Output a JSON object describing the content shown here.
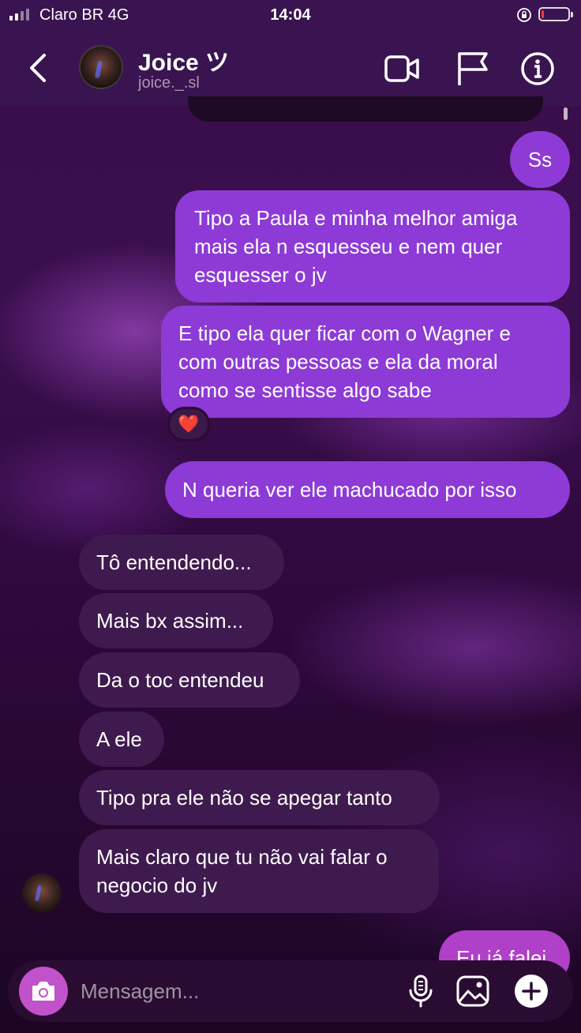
{
  "status_bar": {
    "carrier": "Claro BR   4G",
    "time": "14:04",
    "battery_level": 0.1
  },
  "header": {
    "name": "Joice ツ",
    "username": "joice._.sl",
    "icons": [
      "back-chevron-icon",
      "video-camera-icon",
      "flag-icon",
      "info-icon"
    ]
  },
  "messages": [
    {
      "from": "me",
      "lines": [
        "Ss"
      ]
    },
    {
      "from": "me",
      "lines": [
        "Tipo a Paula e minha melhor amiga",
        "mais ela n esquesseu e nem quer",
        "esquesser o jv"
      ]
    },
    {
      "from": "me",
      "lines": [
        "E tipo ela quer ficar com o Wagner e",
        "com outras pessoas e ela da moral",
        "como se sentisse algo sabe"
      ],
      "reaction": "❤️"
    },
    {
      "from": "me",
      "lines": [
        "N queria ver ele machucado por isso"
      ]
    },
    {
      "from": "them",
      "lines": [
        "Tô entendendo..."
      ]
    },
    {
      "from": "them",
      "lines": [
        "Mais bx assim..."
      ]
    },
    {
      "from": "them",
      "lines": [
        "Da o toc entendeu"
      ]
    },
    {
      "from": "them",
      "lines": [
        "A ele"
      ]
    },
    {
      "from": "them",
      "lines": [
        "Tipo pra ele não se apegar tanto"
      ]
    },
    {
      "from": "them",
      "lines": [
        "Mais claro que tu não vai falar o",
        "negocio do jv"
      ]
    },
    {
      "from": "me",
      "lines": [
        "Eu já falei"
      ]
    }
  ],
  "composer": {
    "placeholder": "Mensagem...",
    "icons": [
      "camera-icon",
      "microphone-icon",
      "gallery-icon",
      "plus-icon"
    ]
  },
  "colors": {
    "outgoing_bubble": "#8d3ad6",
    "incoming_bubble": "#3f1a4e",
    "camera_button": "#c152c9",
    "header": "#3a1450"
  }
}
